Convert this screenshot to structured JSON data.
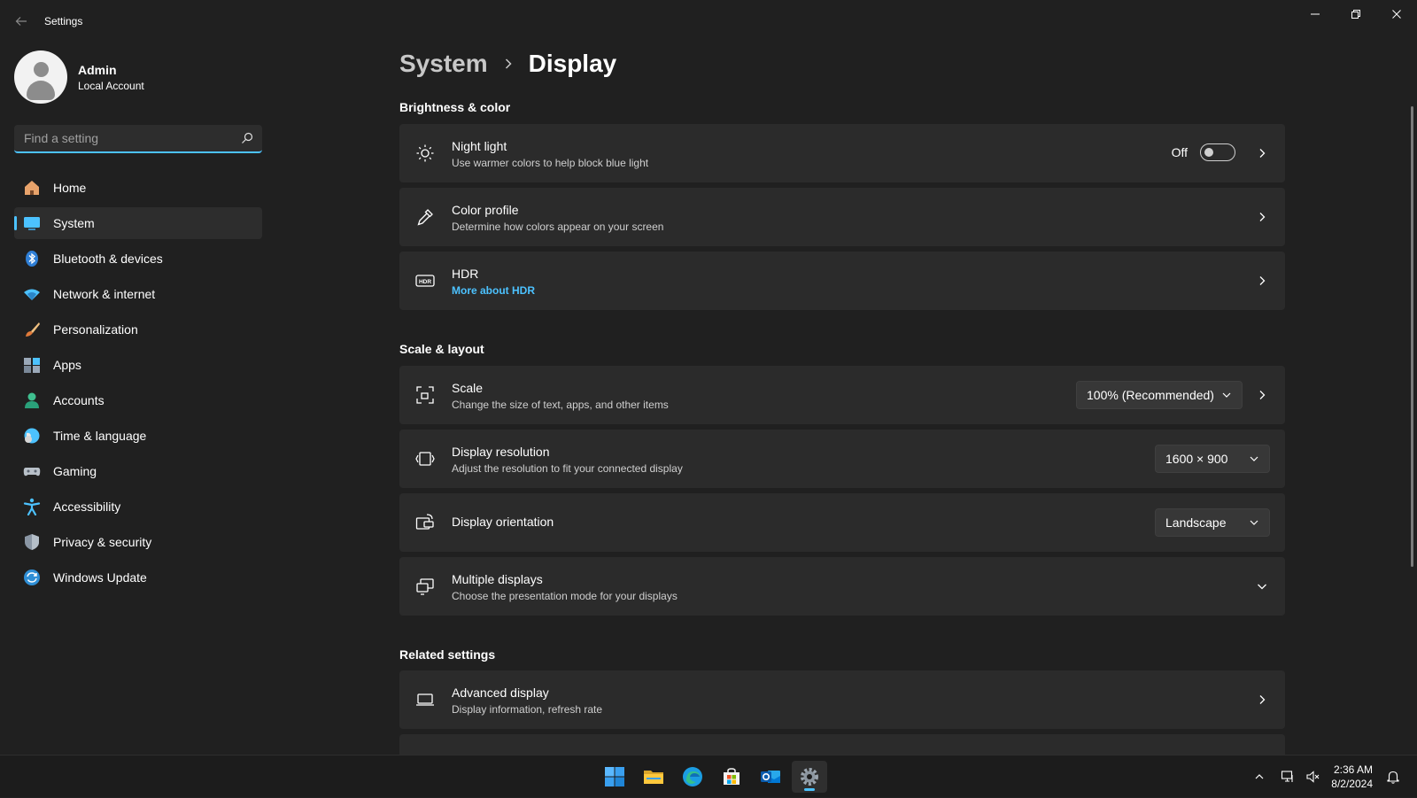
{
  "window": {
    "title": "Settings"
  },
  "profile": {
    "name": "Admin",
    "account_type": "Local Account"
  },
  "search": {
    "placeholder": "Find a setting"
  },
  "sidebar": {
    "items": [
      {
        "label": "Home",
        "icon": "home-icon"
      },
      {
        "label": "System",
        "icon": "system-icon",
        "active": true
      },
      {
        "label": "Bluetooth & devices",
        "icon": "bluetooth-icon"
      },
      {
        "label": "Network & internet",
        "icon": "network-icon"
      },
      {
        "label": "Personalization",
        "icon": "brush-icon"
      },
      {
        "label": "Apps",
        "icon": "apps-icon"
      },
      {
        "label": "Accounts",
        "icon": "accounts-icon"
      },
      {
        "label": "Time & language",
        "icon": "globe-icon"
      },
      {
        "label": "Gaming",
        "icon": "gamepad-icon"
      },
      {
        "label": "Accessibility",
        "icon": "accessibility-icon"
      },
      {
        "label": "Privacy & security",
        "icon": "shield-icon"
      },
      {
        "label": "Windows Update",
        "icon": "update-icon"
      }
    ]
  },
  "breadcrumb": {
    "parent": "System",
    "current": "Display"
  },
  "sections": {
    "brightness": {
      "title": "Brightness & color",
      "night_light": {
        "title": "Night light",
        "desc": "Use warmer colors to help block blue light",
        "toggle_label": "Off",
        "toggle_on": false
      },
      "color_profile": {
        "title": "Color profile",
        "desc": "Determine how colors appear on your screen"
      },
      "hdr": {
        "title": "HDR",
        "link": "More about HDR"
      }
    },
    "scale_layout": {
      "title": "Scale & layout",
      "scale": {
        "title": "Scale",
        "desc": "Change the size of text, apps, and other items",
        "value": "100% (Recommended)"
      },
      "resolution": {
        "title": "Display resolution",
        "desc": "Adjust the resolution to fit your connected display",
        "value": "1600 × 900"
      },
      "orientation": {
        "title": "Display orientation",
        "value": "Landscape"
      },
      "multiple": {
        "title": "Multiple displays",
        "desc": "Choose the presentation mode for your displays"
      }
    },
    "related": {
      "title": "Related settings",
      "advanced": {
        "title": "Advanced display",
        "desc": "Display information, refresh rate"
      }
    }
  },
  "taskbar": {
    "apps": [
      "start-icon",
      "file-explorer-icon",
      "edge-icon",
      "store-icon",
      "outlook-icon",
      "settings-icon"
    ],
    "time": "2:36 AM",
    "date": "8/2/2024"
  },
  "colors": {
    "accent": "#4cc2ff",
    "background": "#202020",
    "card": "#2b2b2b"
  }
}
